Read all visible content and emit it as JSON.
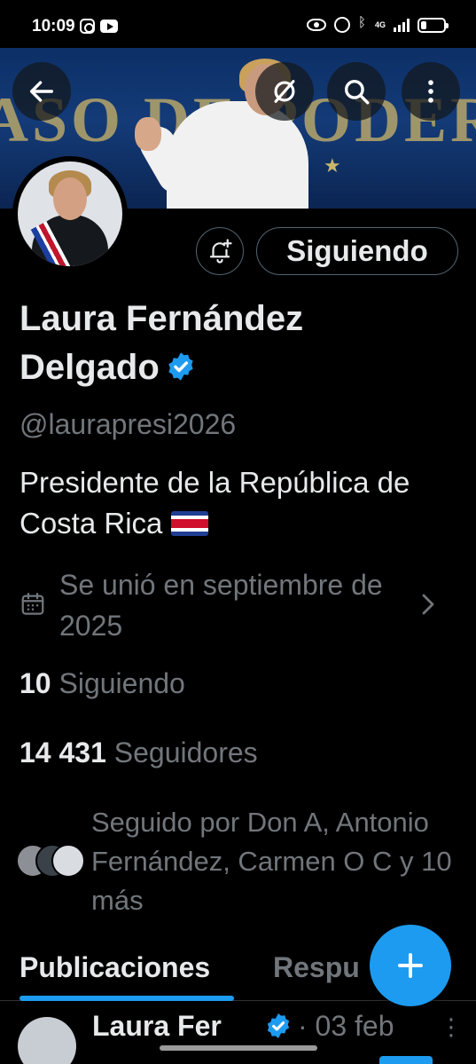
{
  "status_bar": {
    "time": "10:09",
    "network": "4G"
  },
  "header": {
    "back_icon": "arrow-left-icon",
    "grok_icon": "slash-circle-icon",
    "search_icon": "search-icon",
    "more_icon": "more-vertical-icon",
    "banner_text": "ASO DE PODERES"
  },
  "profile": {
    "name": "Laura Fernández Delgado",
    "handle": "@laurapresi2026",
    "bio": "Presidente de la República de Costa Rica",
    "joined": "Se unió en septiembre de 2025",
    "following_count": "10",
    "following_label": "Siguiendo",
    "followers_count": "14 431",
    "followers_label": "Seguidores",
    "followed_by": "Seguido por Don A, Antonio Fernández, Carmen O C y 10 más"
  },
  "actions": {
    "follow_button": "Siguiendo",
    "notify_icon": "bell-plus-icon"
  },
  "tabs": [
    {
      "label": "Publicaciones",
      "active": true
    },
    {
      "label": "Respu",
      "active": false
    }
  ],
  "post": {
    "author": "Laura Fer",
    "date": "· 03 feb",
    "more": "⋮"
  },
  "colors": {
    "accent": "#1d9bf0",
    "background": "#000000",
    "muted": "#71767b",
    "text": "#e7e9ea"
  }
}
